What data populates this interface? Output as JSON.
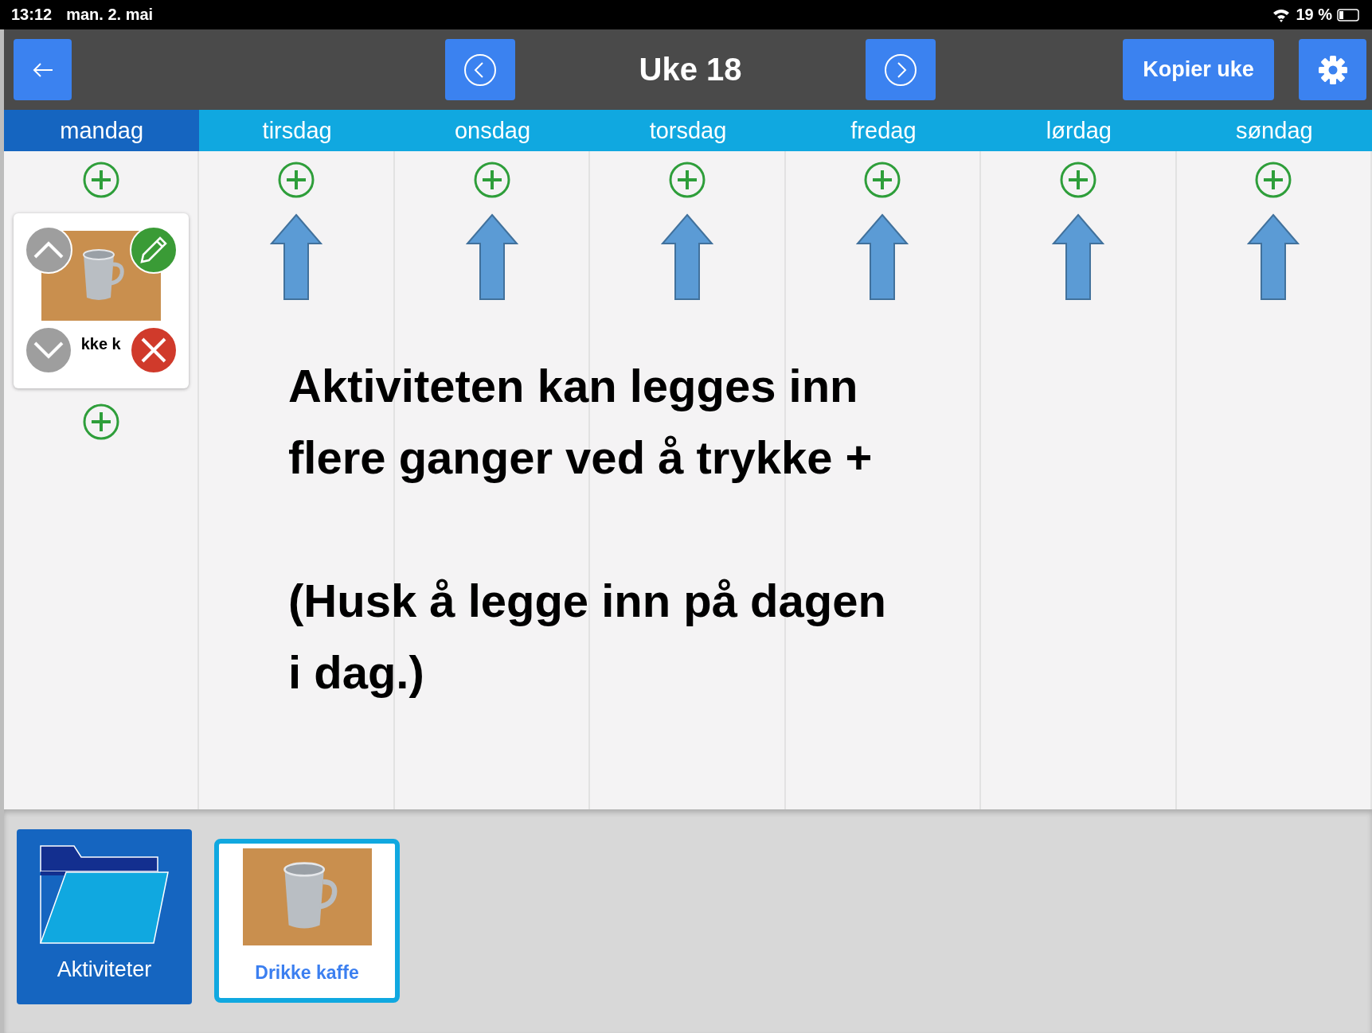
{
  "status_bar": {
    "time": "13:12",
    "date": "man. 2. mai",
    "battery": "19 %"
  },
  "toolbar": {
    "title": "Uke 18",
    "copy_button": "Kopier uke"
  },
  "days": [
    {
      "label": "mandag",
      "selected": true,
      "arrow": false,
      "activities": [
        {
          "label": "kke k"
        }
      ]
    },
    {
      "label": "tirsdag",
      "selected": false,
      "arrow": true
    },
    {
      "label": "onsdag",
      "selected": false,
      "arrow": true
    },
    {
      "label": "torsdag",
      "selected": false,
      "arrow": true
    },
    {
      "label": "fredag",
      "selected": false,
      "arrow": true
    },
    {
      "label": "lørdag",
      "selected": false,
      "arrow": true
    },
    {
      "label": "søndag",
      "selected": false,
      "arrow": true
    }
  ],
  "annotation": {
    "paragraphs": [
      [
        "Aktiviteten kan legges inn",
        "flere ganger ved å trykke +"
      ],
      [
        "(Husk å legge inn på dagen",
        "i dag.)"
      ]
    ]
  },
  "tray": [
    {
      "kind": "folder",
      "label": "Aktiviteter",
      "selected": false
    },
    {
      "kind": "activity",
      "label": "Drikke kaffe",
      "selected": true
    }
  ]
}
